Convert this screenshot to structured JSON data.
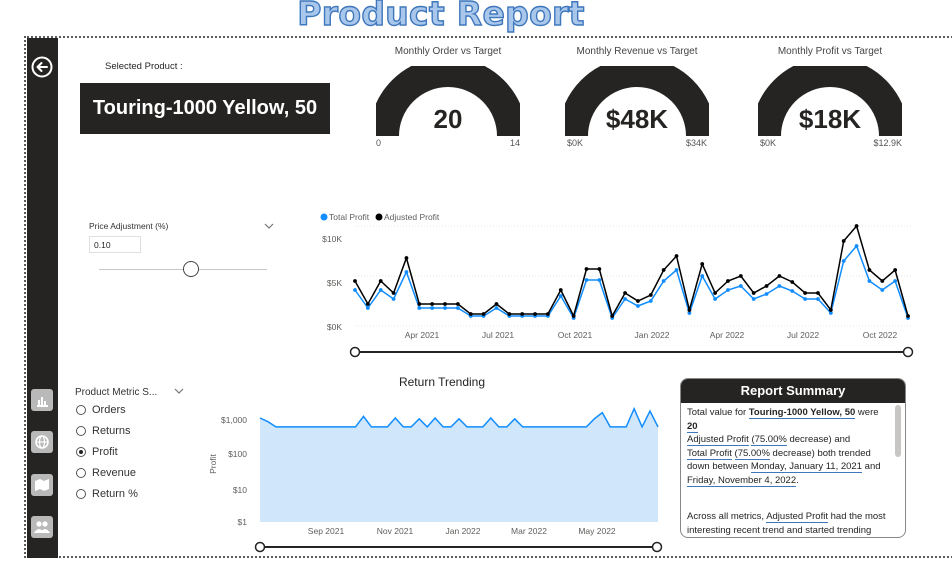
{
  "header": {
    "title": "Product Report"
  },
  "selected_product": {
    "label": "Selected Product :",
    "value": "Touring-1000 Yellow, 50"
  },
  "gauges": [
    {
      "title": "Monthly Order vs Target",
      "value": "20",
      "min": "0",
      "max": "14",
      "fraction": 1.0
    },
    {
      "title": "Monthly Revenue vs Target",
      "value": "$48K",
      "min": "$0K",
      "max": "$34K",
      "fraction": 1.0
    },
    {
      "title": "Monthly Profit vs Target",
      "value": "$18K",
      "min": "$0K",
      "max": "$12.9K",
      "fraction": 1.0
    }
  ],
  "price_adjustment": {
    "label": "Price Adjustment (%)",
    "value": "0.10"
  },
  "metric_slicer": {
    "label": "Product Metric S...",
    "options": [
      "Orders",
      "Returns",
      "Profit",
      "Revenue",
      "Return %"
    ],
    "selected": "Profit"
  },
  "chart_data": [
    {
      "type": "line",
      "legend": {
        "position": "top-left"
      },
      "series": [
        {
          "name": "Total Profit",
          "color": "#118dff",
          "values": [
            3.6,
            1.8,
            3.6,
            2.7,
            5.4,
            1.8,
            1.8,
            1.8,
            1.8,
            1.0,
            1.0,
            1.8,
            1.0,
            1.0,
            1.0,
            1.0,
            3.0,
            0.8,
            4.6,
            4.6,
            0.8,
            2.7,
            2.0,
            2.5,
            4.5,
            5.6,
            1.3,
            5.0,
            2.7,
            3.6,
            4.0,
            2.7,
            3.2,
            4.0,
            3.5,
            2.7,
            2.7,
            1.3,
            6.5,
            8.0,
            4.5,
            3.6,
            4.5,
            0.8
          ]
        },
        {
          "name": "Adjusted Profit",
          "color": "#000000",
          "values": [
            4.5,
            2.2,
            4.5,
            3.3,
            6.8,
            2.2,
            2.2,
            2.2,
            2.2,
            1.2,
            1.2,
            2.2,
            1.2,
            1.2,
            1.2,
            1.2,
            3.6,
            1.0,
            5.7,
            5.7,
            1.0,
            3.3,
            2.5,
            3.1,
            5.6,
            7.0,
            1.6,
            6.2,
            3.3,
            4.5,
            5.0,
            3.3,
            4.0,
            5.0,
            4.4,
            3.3,
            3.3,
            1.6,
            8.5,
            10.0,
            5.6,
            4.5,
            5.6,
            1.0
          ]
        }
      ],
      "x_labels": [
        "Apr 2021",
        "Jul 2021",
        "Oct 2021",
        "Jan 2022",
        "Apr 2022",
        "Jul 2022",
        "Oct 2022"
      ],
      "y_ticks": [
        "$0K",
        "$5K",
        "$10K"
      ],
      "ylim": [
        0,
        11
      ]
    },
    {
      "type": "area",
      "title": "Return Trending",
      "ylabel": "Profit",
      "y_scale": "log",
      "color": "#118dff",
      "fill": "#cfe6fb",
      "x_labels": [
        "Sep 2021",
        "Nov 2021",
        "Jan 2022",
        "Mar 2022",
        "May 2022"
      ],
      "y_ticks": [
        "$1",
        "$10",
        "$100",
        "$1,000"
      ],
      "values": [
        1700,
        1300,
        900,
        900,
        900,
        900,
        900,
        900,
        900,
        900,
        900,
        900,
        900,
        1900,
        900,
        900,
        900,
        1700,
        900,
        900,
        1600,
        900,
        1700,
        900,
        900,
        1600,
        900,
        900,
        900,
        1700,
        900,
        900,
        1600,
        900,
        900,
        900,
        900,
        900,
        900,
        900,
        900,
        900,
        1600,
        2500,
        900,
        900,
        900,
        3300,
        900,
        2800,
        900
      ]
    }
  ],
  "summary": {
    "title": "Report Summary",
    "p1_a": "Total value for ",
    "p1_product": "Touring-1000 Yellow, 50",
    "p1_b": " were",
    "p1_value": "20",
    "p2_m1": "Adjusted Profit",
    "p2_pct1": "(75.00%",
    "p2_b": " decrease) and",
    "p2_m2": "Total Profit",
    "p2_pct2": "(75.00%",
    "p2_c": " decrease) both trended down between ",
    "p2_d1": "Monday, January 11, 2021",
    "p2_and": " and",
    "p2_d2": "Friday, November 4, 2022",
    "p2_end": ".",
    "p3_a": "Across all metrics, ",
    "p3_m": "Adjusted Profit",
    "p3_b": " had the most interesting recent trend and started trending"
  }
}
